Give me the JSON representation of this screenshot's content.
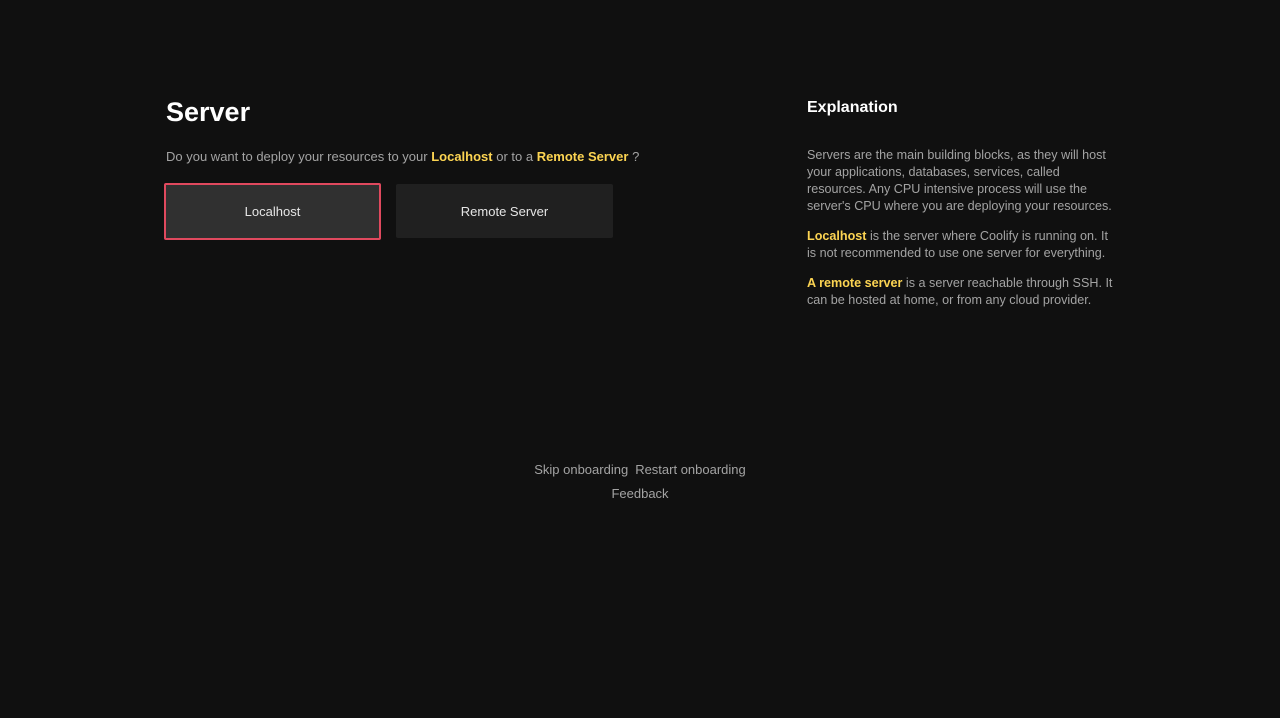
{
  "main": {
    "title": "Server",
    "question": {
      "prefix": "Do you want to deploy your resources to your ",
      "localhost": "Localhost",
      "middle": " or to a ",
      "remote": "Remote Server",
      "suffix": " ?"
    },
    "buttons": {
      "localhost": "Localhost",
      "remote": "Remote Server"
    },
    "selected": "localhost"
  },
  "explanation": {
    "title": "Explanation",
    "p1": "Servers are the main building blocks, as they will host your applications, databases, services, called resources. Any CPU intensive process will use the server's CPU where you are deploying your resources.",
    "p2": {
      "highlight": "Localhost",
      "text": " is the server where Coolify is running on. It is not recommended to use one server for everything."
    },
    "p3": {
      "highlight": "A remote server",
      "text": " is a server reachable through SSH. It can be hosted at home, or from any cloud provider."
    }
  },
  "footer": {
    "skip": "Skip onboarding",
    "restart": "Restart onboarding",
    "feedback": "Feedback"
  },
  "colors": {
    "background": "#101010",
    "highlight": "#fcd452",
    "selected_border": "#e0495e",
    "button_bg": "#202020",
    "button_selected_bg": "#303030"
  }
}
